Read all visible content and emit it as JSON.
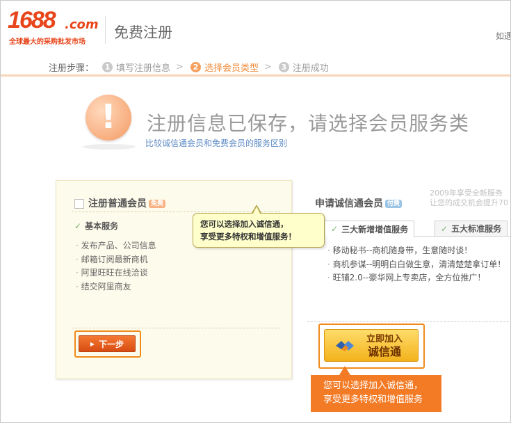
{
  "header": {
    "logo_num": "1688",
    "logo_com": ".com",
    "logo_tagline": "全球最大的采购批发市场",
    "title": "免费注册",
    "right_text": "如遇"
  },
  "steps": {
    "label": "注册步骤：",
    "items": [
      {
        "num": "1",
        "label": "填写注册信息"
      },
      {
        "num": "2",
        "label": "选择会员类型"
      },
      {
        "num": "3",
        "label": "注册成功"
      }
    ]
  },
  "message": {
    "icon": "!",
    "title": "注册信息已保存，请选择会员服务类",
    "compare_link": "比较诚信通会员和免费会员的服务区别"
  },
  "free_member": {
    "title": "注册普通会员",
    "badge": "免费",
    "section": "基本服务",
    "items": [
      "发布产品、公司信息",
      "邮箱订阅最新商机",
      "阿里旺旺在线洽谈",
      "结交阿里商友"
    ],
    "next_button": "下一步"
  },
  "tooltip_yellow": {
    "line1": "您可以选择加入诚信通，",
    "line2": "享受更多特权和增值服务！"
  },
  "trustpass": {
    "title": "申请诚信通会员",
    "badge": "付费",
    "note_line1": "2009年享受全新服务",
    "note_line2": "让您的成交机会提升70",
    "tabs": [
      "三大新增增值服务",
      "五大标准服务"
    ],
    "items": [
      "移动秘书--商机随身带，生意随时谈！",
      "商机参谋--明明白白做生意，清清楚楚拿订单！",
      "旺铺2.0--豪华网上专卖店，全方位推广！"
    ],
    "join_line1": "立即加入",
    "join_line2": "诚信通"
  },
  "tooltip_orange": {
    "line1": "您可以选择加入诚信通，",
    "line2": "享受更多特权和增值服务"
  },
  "colors": {
    "accent": "#f37b26",
    "logo": "#e8451b",
    "link": "#5e8bc5"
  }
}
